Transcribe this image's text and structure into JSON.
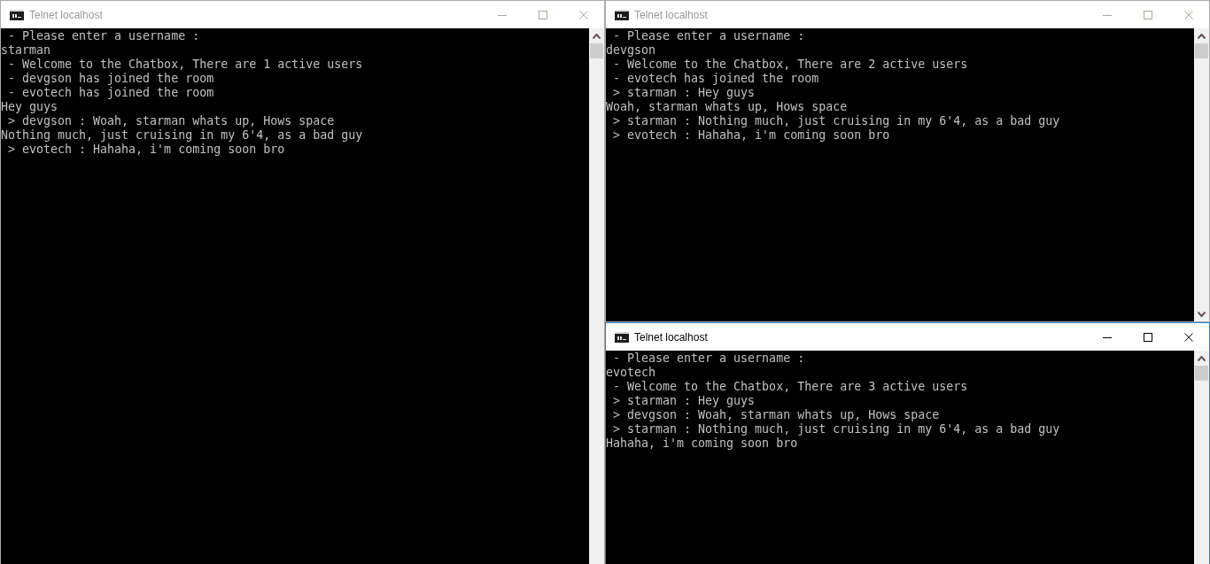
{
  "windows": [
    {
      "title": "Telnet localhost",
      "active": false,
      "lines": [
        " - Please enter a username :",
        "starman",
        " - Welcome to the Chatbox, There are 1 active users",
        " - devgson has joined the room",
        " - evotech has joined the room",
        "Hey guys",
        " > devgson : Woah, starman whats up, Hows space",
        "Nothing much, just cruising in my 6'4, as a bad guy",
        " > evotech : Hahaha, i'm coming soon bro"
      ]
    },
    {
      "title": "Telnet localhost",
      "active": false,
      "lines": [
        " - Please enter a username :",
        "devgson",
        " - Welcome to the Chatbox, There are 2 active users",
        " - evotech has joined the room",
        " > starman : Hey guys",
        "Woah, starman whats up, Hows space",
        " > starman : Nothing much, just cruising in my 6'4, as a bad guy",
        " > evotech : Hahaha, i'm coming soon bro"
      ]
    },
    {
      "title": "Telnet localhost",
      "active": true,
      "lines": [
        " - Please enter a username :",
        "evotech",
        " - Welcome to the Chatbox, There are 3 active users",
        " > starman : Hey guys",
        " > devgson : Woah, starman whats up, Hows space",
        " > starman : Nothing much, just cruising in my 6'4, as a bad guy",
        "Hahaha, i'm coming soon bro"
      ]
    }
  ]
}
